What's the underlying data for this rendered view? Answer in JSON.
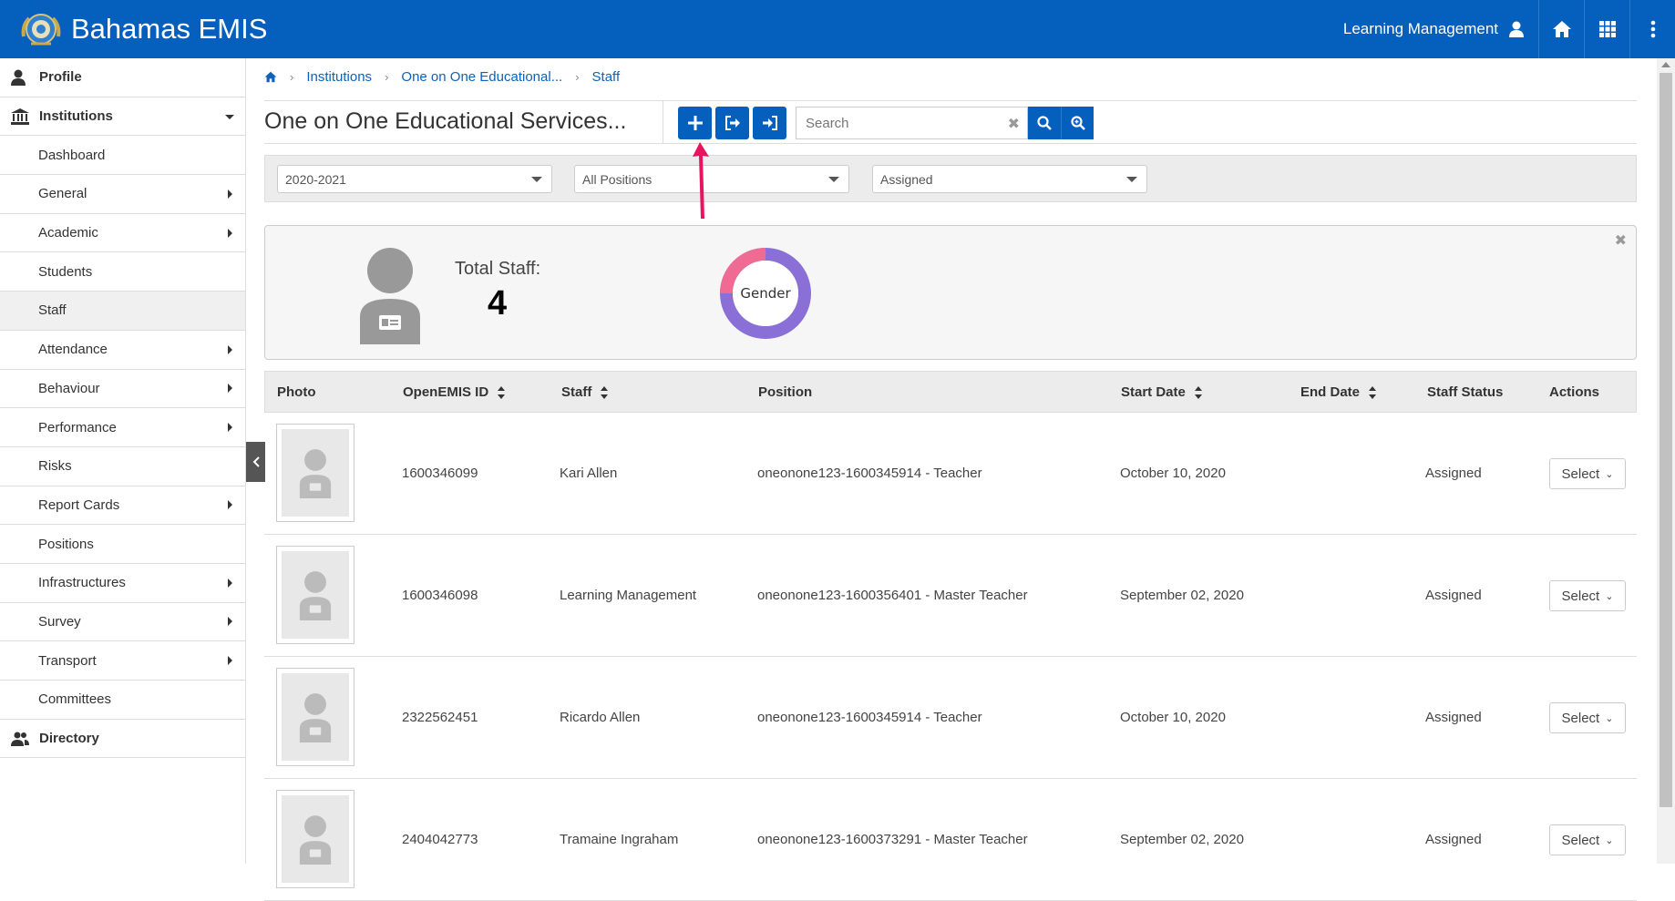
{
  "header": {
    "brand": "Bahamas EMIS",
    "user_name": "Learning Management"
  },
  "sidebar": {
    "items": [
      {
        "label": "Profile",
        "level": "top",
        "icon": "user-icon"
      },
      {
        "label": "Institutions",
        "level": "top",
        "icon": "bank-icon",
        "expanded": true
      },
      {
        "label": "Dashboard",
        "level": "sub"
      },
      {
        "label": "General",
        "level": "sub",
        "has_children": true
      },
      {
        "label": "Academic",
        "level": "sub",
        "has_children": true
      },
      {
        "label": "Students",
        "level": "sub"
      },
      {
        "label": "Staff",
        "level": "sub",
        "active": true
      },
      {
        "label": "Attendance",
        "level": "sub",
        "has_children": true
      },
      {
        "label": "Behaviour",
        "level": "sub",
        "has_children": true
      },
      {
        "label": "Performance",
        "level": "sub",
        "has_children": true
      },
      {
        "label": "Risks",
        "level": "sub"
      },
      {
        "label": "Report Cards",
        "level": "sub",
        "has_children": true
      },
      {
        "label": "Positions",
        "level": "sub"
      },
      {
        "label": "Infrastructures",
        "level": "sub",
        "has_children": true
      },
      {
        "label": "Survey",
        "level": "sub",
        "has_children": true
      },
      {
        "label": "Transport",
        "level": "sub",
        "has_children": true
      },
      {
        "label": "Committees",
        "level": "sub"
      },
      {
        "label": "Directory",
        "level": "top",
        "icon": "users-icon"
      }
    ]
  },
  "breadcrumb": {
    "items": [
      "Institutions",
      "One on One Educational...",
      "Staff"
    ]
  },
  "page": {
    "title": "One on One Educational Services..."
  },
  "search": {
    "placeholder": "Search",
    "value": ""
  },
  "filters": {
    "academic_period": "2020-2021",
    "position": "All Positions",
    "status": "Assigned"
  },
  "stats": {
    "total_label": "Total Staff:",
    "total_value": "4",
    "chart_label": "Gender"
  },
  "table": {
    "columns": [
      "Photo",
      "OpenEMIS ID",
      "Staff",
      "Position",
      "Start Date",
      "End Date",
      "Staff Status",
      "Actions"
    ],
    "rows": [
      {
        "openemis_id": "1600346099",
        "staff": "Kari Allen",
        "position": "oneonone123-1600345914 - Teacher",
        "start_date": "October 10, 2020",
        "end_date": "",
        "status": "Assigned",
        "action": "Select"
      },
      {
        "openemis_id": "1600346098",
        "staff": "Learning Management",
        "position": "oneonone123-1600356401 - Master Teacher",
        "start_date": "September 02, 2020",
        "end_date": "",
        "status": "Assigned",
        "action": "Select"
      },
      {
        "openemis_id": "2322562451",
        "staff": "Ricardo Allen",
        "position": "oneonone123-1600345914 - Teacher",
        "start_date": "October 10, 2020",
        "end_date": "",
        "status": "Assigned",
        "action": "Select"
      },
      {
        "openemis_id": "2404042773",
        "staff": "Tramaine Ingraham",
        "position": "oneonone123-1600373291 - Master Teacher",
        "start_date": "September 02, 2020",
        "end_date": "",
        "status": "Assigned",
        "action": "Select"
      }
    ]
  },
  "colors": {
    "primary": "#0560bd",
    "donut_male": "#8a6fd6",
    "donut_female": "#ef6b94",
    "annotation_arrow": "#e8155e"
  }
}
